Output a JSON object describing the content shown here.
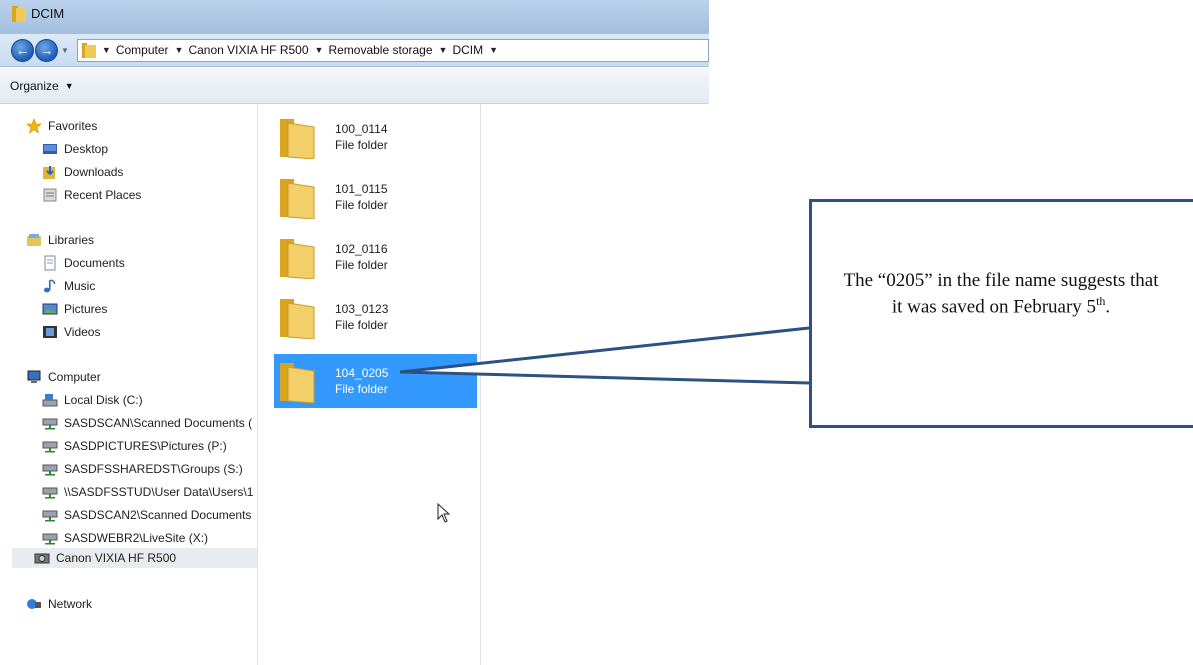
{
  "window": {
    "title": "DCIM"
  },
  "address_bar": {
    "breadcrumbs": [
      "Computer",
      "Canon VIXIA HF R500",
      "Removable storage",
      "DCIM"
    ]
  },
  "command_bar": {
    "organize_label": "Organize"
  },
  "nav_pane": {
    "favorites": {
      "label": "Favorites",
      "items": [
        "Desktop",
        "Downloads",
        "Recent Places"
      ]
    },
    "libraries": {
      "label": "Libraries",
      "items": [
        "Documents",
        "Music",
        "Pictures",
        "Videos"
      ]
    },
    "computer": {
      "label": "Computer",
      "items": [
        "Local Disk (C:)",
        "SASDSCAN\\Scanned Documents (",
        "SASDPICTURES\\Pictures (P:)",
        "SASDFSSHAREDST\\Groups (S:)",
        "\\\\SASDFSSTUD\\User Data\\Users\\1",
        "SASDSCAN2\\Scanned Documents",
        "SASDWEBR2\\LiveSite (X:)",
        "Canon VIXIA HF R500"
      ],
      "selected_item": "Canon VIXIA HF R500"
    },
    "network": {
      "label": "Network"
    }
  },
  "folders": [
    {
      "name": "100_0114",
      "type": "File folder"
    },
    {
      "name": "101_0115",
      "type": "File folder"
    },
    {
      "name": "102_0116",
      "type": "File folder"
    },
    {
      "name": "103_0123",
      "type": "File folder"
    },
    {
      "name": "104_0205",
      "type": "File folder",
      "selected": true
    }
  ],
  "callout": {
    "text_before": "The “0205” in the file name suggests that it was saved on February 5",
    "superscript": "th",
    "text_after": "."
  },
  "colors": {
    "selection": "#3399ff",
    "callout_border": "#2b5283",
    "title_bar": "#b9d1ea"
  }
}
